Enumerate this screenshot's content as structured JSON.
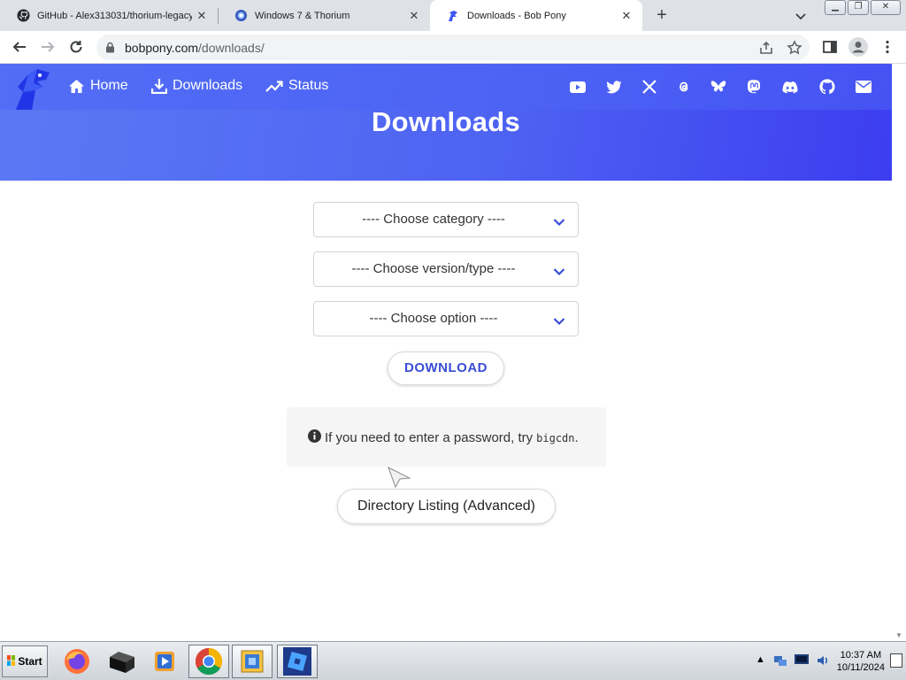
{
  "browser": {
    "tabs": [
      {
        "title": "GitHub - Alex313031/thorium-legacy"
      },
      {
        "title": "Windows 7 & Thorium"
      },
      {
        "title": "Downloads - Bob Pony"
      }
    ],
    "url_host": "bobpony.com",
    "url_path": "/downloads/"
  },
  "site": {
    "nav": {
      "home": "Home",
      "downloads": "Downloads",
      "status": "Status"
    },
    "social_icons": [
      "youtube-icon",
      "twitter-icon",
      "x-icon",
      "threads-icon",
      "bluesky-icon",
      "mastodon-icon",
      "discord-icon",
      "github-icon",
      "email-icon"
    ],
    "page_title": "Downloads",
    "form": {
      "category": "---- Choose category ----",
      "version": "---- Choose version/type ----",
      "option": "---- Choose option ----",
      "download_button": "DOWNLOAD"
    },
    "notice": {
      "text": "If you need to enter a password, try",
      "code": "bigcdn",
      "end": "."
    },
    "directory_button": "Directory Listing (Advanced)"
  },
  "taskbar": {
    "start_label": "Start",
    "time": "10:37 AM",
    "date": "10/11/2024"
  },
  "colors": {
    "header_gradient_start": "#5b79f4",
    "header_gradient_end": "#3c3df0",
    "button_text": "#3a4cd6"
  }
}
